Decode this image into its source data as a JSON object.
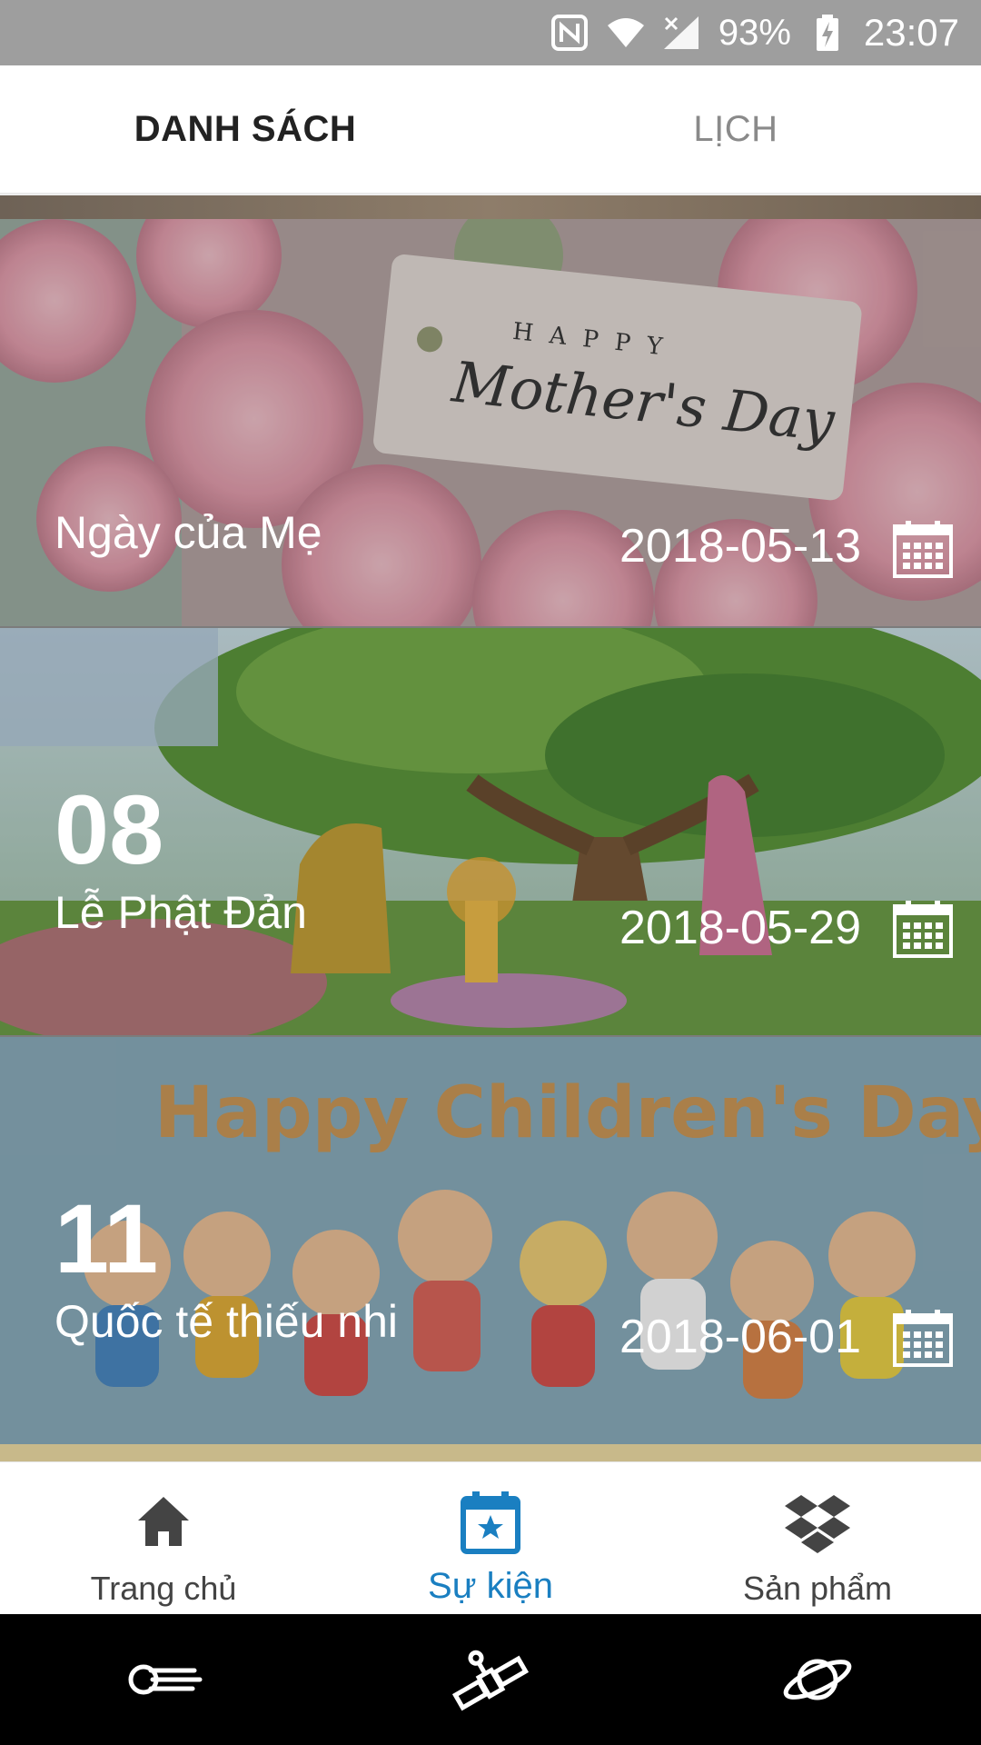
{
  "status_bar": {
    "battery": "93%",
    "time": "23:07",
    "icons": [
      "nfc-icon",
      "wifi-icon",
      "signal-icon",
      "battery-charging-icon"
    ]
  },
  "tabs": [
    {
      "label": "DANH SÁCH",
      "active": true
    },
    {
      "label": "LỊCH",
      "active": false
    }
  ],
  "events": [
    {
      "day": "",
      "title": "Ngày của Mẹ",
      "date": "2018-05-13",
      "banner_text": "HAPPY Mother's Day",
      "icon": "calendar-icon"
    },
    {
      "day": "08",
      "title": "Lễ Phật Đản",
      "date": "2018-05-29",
      "banner_text": "",
      "icon": "calendar-icon"
    },
    {
      "day": "11",
      "title": "Quốc tế thiếu nhi",
      "date": "2018-06-01",
      "banner_text": "Happy Children's Day",
      "icon": "calendar-icon"
    }
  ],
  "bottom_nav": [
    {
      "label": "Trang chủ",
      "icon": "home-icon",
      "active": false
    },
    {
      "label": "Sự kiện",
      "icon": "event-calendar-icon",
      "active": true
    },
    {
      "label": "Sản phẩm",
      "icon": "dropbox-icon",
      "active": false
    }
  ],
  "system_nav": [
    "comet-icon",
    "satellite-icon",
    "planet-icon"
  ],
  "colors": {
    "accent": "#1a7fc1",
    "status_bar": "#9e9e9e",
    "tab_active": "#222222",
    "tab_inactive": "#8a8a8a"
  }
}
